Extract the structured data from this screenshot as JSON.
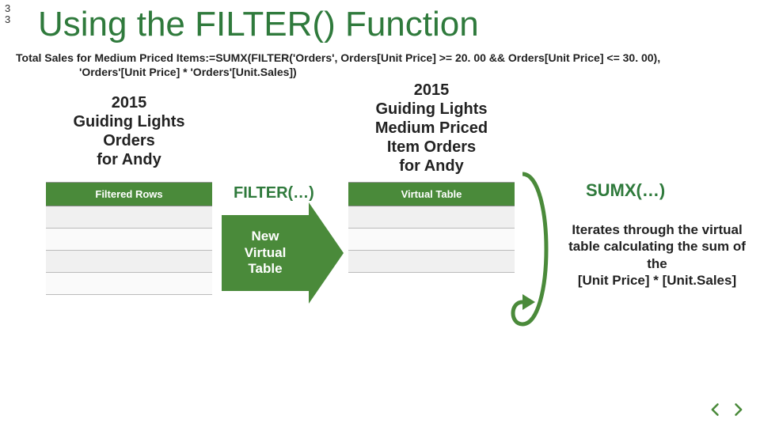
{
  "page_number_top": "3",
  "page_number_bottom": "3",
  "title": "Using the FILTER() Function",
  "formula_line1": "Total Sales for Medium Priced Items:=SUMX(FILTER('Orders', Orders[Unit Price] >= 20. 00 && Orders[Unit Price] <= 30. 00),",
  "formula_line2": "'Orders'[Unit Price] * 'Orders'[Unit.Sales])",
  "left_table": {
    "title": "2015\nGuiding Lights\nOrders\nfor Andy",
    "header": "Filtered Rows"
  },
  "right_table": {
    "title": "2015\nGuiding Lights\nMedium Priced\nItem Orders\nfor Andy",
    "header": "Virtual Table"
  },
  "filter_label": "FILTER(…)",
  "arrow_text": "New\nVirtual\nTable",
  "sumx_label": "SUMX(…)",
  "sumx_desc": "Iterates through the virtual table calculating the sum of the\n[Unit Price] * [Unit.Sales]",
  "colors": {
    "accent": "#4a8a3a",
    "title": "#2f7a3c"
  }
}
